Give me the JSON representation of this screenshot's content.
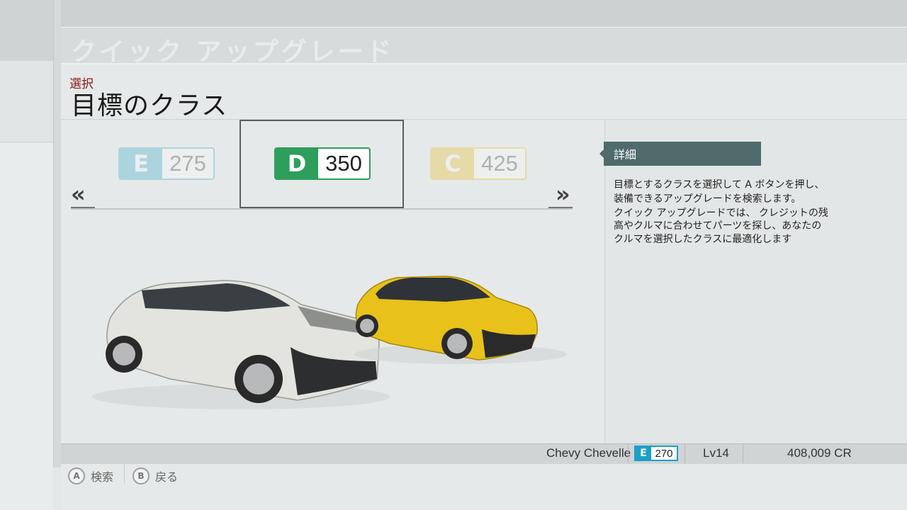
{
  "header": {
    "title": "クイック アップグレード"
  },
  "section": {
    "label": "選択",
    "title": "目標のクラス"
  },
  "class_options": [
    {
      "letter": "E",
      "value": "275",
      "color": "#1aa0c7",
      "state": "dimmed"
    },
    {
      "letter": "D",
      "value": "350",
      "color": "#2e9e5b",
      "state": "selected"
    },
    {
      "letter": "C",
      "value": "425",
      "color": "#e6b800",
      "state": "dimmed"
    }
  ],
  "nav": {
    "prev_icon": "«",
    "next_icon": "»"
  },
  "details": {
    "title": "詳細",
    "lines": [
      "目標とするクラスを選択して A ボタンを押し、",
      "装備できるアップグレードを検索します。",
      "クイック アップグレードでは、 クレジットの残",
      "高やクルマに合わせてパーツを探し、あなたの",
      "クルマを選択したクラスに最適化します"
    ]
  },
  "status": {
    "car_name": "Chevy Chevelle",
    "car_class": {
      "letter": "E",
      "value": "270",
      "color": "#1aa0c7"
    },
    "level": "Lv14",
    "credits": "408,009 CR"
  },
  "buttons": [
    {
      "icon": "A",
      "label": "検索"
    },
    {
      "icon": "B",
      "label": "戻る"
    }
  ],
  "cars": [
    {
      "name": "white-hatchback",
      "color": "#e6e6e2"
    },
    {
      "name": "yellow-hatchback",
      "color": "#e8c21a"
    }
  ]
}
